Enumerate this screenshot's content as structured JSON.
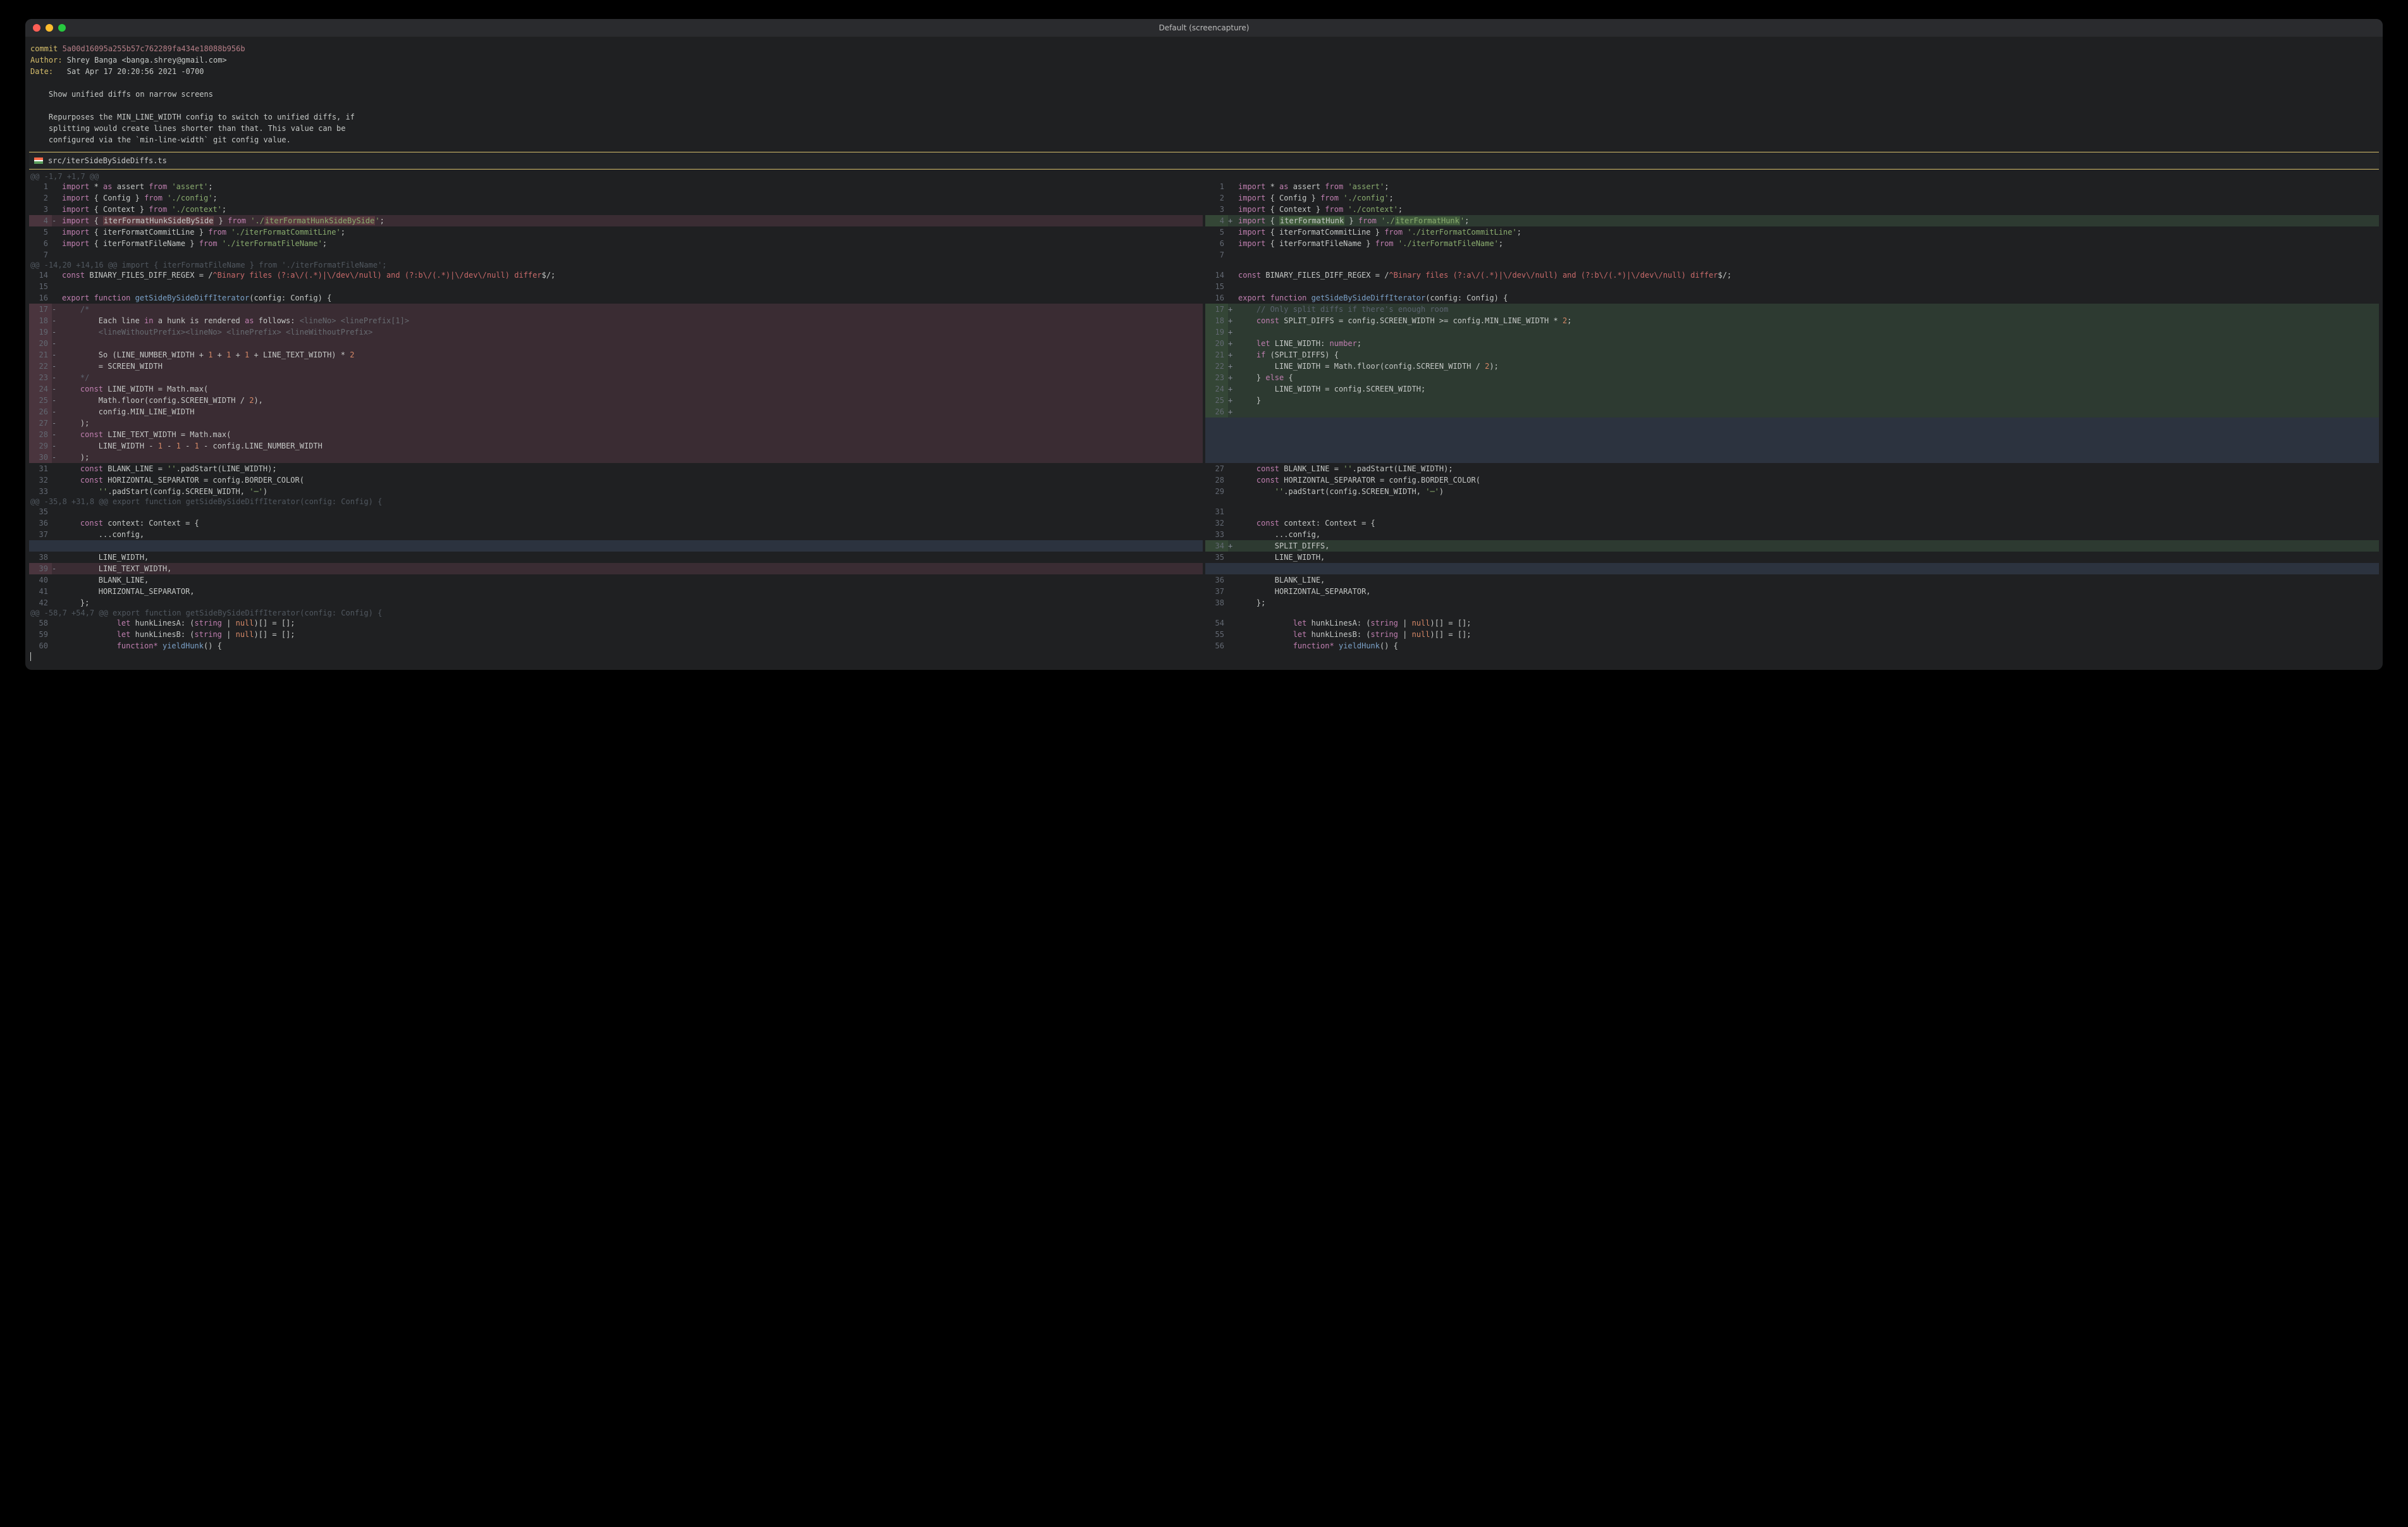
{
  "window": {
    "title": "Default (screencapture)"
  },
  "commit": {
    "label_commit": "commit ",
    "hash": "5a00d16095a255b57c762289fa434e18088b956b",
    "label_author": "Author: ",
    "author": "Shrey Banga <banga.shrey@gmail.com>",
    "label_date": "Date:   ",
    "date": "Sat Apr 17 20:20:56 2021 -0700",
    "subject": "    Show unified diffs on narrow screens",
    "body1": "    Repurposes the MIN_LINE_WIDTH config to switch to unified diffs, if",
    "body2": "    splitting would create lines shorter than that. This value can be",
    "body3": "    configured via the `min-line-width` git config value."
  },
  "file": {
    "path": "src/iterSideBySideDiffs.ts"
  },
  "hunks": {
    "h1": "@@ -1,7 +1,7 @@",
    "h2": "@@ -14,20 +14,16 @@ import { iterFormatFileName } from './iterFormatFileName';",
    "h3": "@@ -35,8 +31,8 @@ export function getSideBySideDiffIterator(config: Config) {",
    "h4": "@@ -58,7 +54,7 @@ export function getSideBySideDiffIterator(config: Config) {"
  },
  "left": {
    "l1_ln": "1",
    "l1": [
      "import",
      " * ",
      "as",
      " assert ",
      "from",
      " ",
      "'assert'",
      ";"
    ],
    "l2_ln": "2",
    "l2": [
      "import",
      " { Config } ",
      "from",
      " ",
      "'./config'",
      ";"
    ],
    "l3_ln": "3",
    "l3": [
      "import",
      " { Context } ",
      "from",
      " ",
      "'./context'",
      ";"
    ],
    "l4_ln": "4",
    "l4a": "import",
    "l4b": " { ",
    "l4hl": "iterFormatHunkSideBySide",
    "l4c": " } ",
    "l4d": "from",
    "l4e": " ",
    "l4f": "'./",
    "l4f2": "iterFormatHunkSideBySide",
    "l4g": "'",
    "l4h": ";",
    "l5_ln": "5",
    "l5": [
      "import",
      " { iterFormatCommitLine } ",
      "from",
      " ",
      "'./iterFormatCommitLine'",
      ";"
    ],
    "l6_ln": "6",
    "l6": [
      "import",
      " { iterFormatFileName } ",
      "from",
      " ",
      "'./iterFormatFileName'",
      ";"
    ],
    "l7_ln": "7",
    "l7": "",
    "l14_ln": "14",
    "l14a": "const",
    "l14b": " BINARY_FILES_DIFF_REGEX = /",
    "l14c": "^Binary files (?:a\\/(.*)|\\/dev\\/null) and (?:b\\/(.*)|\\/dev\\/null) differ",
    "l14d": "$/;",
    "l15_ln": "15",
    "l15": "",
    "l16_ln": "16",
    "l16a": "export",
    "l16b": " ",
    "l16c": "function",
    "l16d": " ",
    "l16e": "getSideBySideDiffIterator",
    "l16f": "(config: Config) {",
    "l17_ln": "17",
    "l17": "    /*",
    "l18_ln": "18",
    "l18a": "        Each line ",
    "l18b": "in",
    "l18c": " a hunk is rendered ",
    "l18d": "as",
    "l18e": " follows: ",
    "l18f": "<lineNo>",
    "l18g": " ",
    "l18h": "<linePrefix[1]>",
    "l19_ln": "19",
    "l19a": "        ",
    "l19b": "<lineWithoutPrefix><lineNo>",
    "l19c": " ",
    "l19d": "<linePrefix>",
    "l19e": " ",
    "l19f": "<lineWithoutPrefix>",
    "l20_ln": "20",
    "l20": "",
    "l21_ln": "21",
    "l21a": "        So (LINE_NUMBER_WIDTH + ",
    "l21b": "1",
    "l21c": " + ",
    "l21d": "1",
    "l21e": " + ",
    "l21f": "1",
    "l21g": " + LINE_TEXT_WIDTH) * ",
    "l21h": "2",
    "l22_ln": "22",
    "l22": "        = SCREEN_WIDTH",
    "l23_ln": "23",
    "l23": "    */",
    "l24_ln": "24",
    "l24a": "    ",
    "l24b": "const",
    "l24c": " LINE_WIDTH = Math.max(",
    "l25_ln": "25",
    "l25a": "        Math.floor(config.SCREEN_WIDTH / ",
    "l25b": "2",
    "l25c": "),",
    "l26_ln": "26",
    "l26": "        config.MIN_LINE_WIDTH",
    "l27_ln": "27",
    "l27": "    );",
    "l28_ln": "28",
    "l28a": "    ",
    "l28b": "const",
    "l28c": " LINE_TEXT_WIDTH = Math.max(",
    "l29_ln": "29",
    "l29a": "        LINE_WIDTH - ",
    "l29b": "1",
    "l29c": " - ",
    "l29d": "1",
    "l29e": " - ",
    "l29f": "1",
    "l29g": " - config.LINE_NUMBER_WIDTH",
    "l30_ln": "30",
    "l30": "    );",
    "l31_ln": "31",
    "l31a": "    ",
    "l31b": "const",
    "l31c": " BLANK_LINE = ",
    "l31d": "''",
    "l31e": ".padStart(LINE_WIDTH);",
    "l32_ln": "32",
    "l32a": "    ",
    "l32b": "const",
    "l32c": " HORIZONTAL_SEPARATOR = config.BORDER_COLOR(",
    "l33_ln": "33",
    "l33a": "        ",
    "l33b": "''",
    "l33c": ".padStart(config.SCREEN_WIDTH, ",
    "l33d": "'─'",
    "l33e": ")",
    "l36_ln": "36",
    "l36a": "    ",
    "l36b": "const",
    "l36c": " context: Context = {",
    "l37_ln": "37",
    "l37": "        ...config,",
    "l38_ln": "38",
    "l38": "        LINE_WIDTH,",
    "l39_ln": "39",
    "l39": "        LINE_TEXT_WIDTH,",
    "l40_ln": "40",
    "l40": "        BLANK_LINE,",
    "l41_ln": "41",
    "l41": "        HORIZONTAL_SEPARATOR,",
    "l42_ln": "42",
    "l42": "    };",
    "l58_ln": "58",
    "l58a": "            ",
    "l58b": "let",
    "l58c": " hunkLinesA: (",
    "l58d": "string",
    "l58e": " | ",
    "l58f": "null",
    "l58g": ")[] = [];",
    "l59_ln": "59",
    "l59a": "            ",
    "l59b": "let",
    "l59c": " hunkLinesB: (",
    "l59d": "string",
    "l59e": " | ",
    "l59f": "null",
    "l59g": ")[] = [];",
    "l60_ln": "60",
    "l60a": "            ",
    "l60b": "function*",
    "l60c": " ",
    "l60d": "yieldHunk",
    "l60e": "() {"
  },
  "right": {
    "l1_ln": "1",
    "l2_ln": "2",
    "l3_ln": "3",
    "l4_ln": "4",
    "l4a": "import",
    "l4b": " { ",
    "l4hl": "iterFormatHunk",
    "l4c": " } ",
    "l4d": "from",
    "l4e": " ",
    "l4f": "'./",
    "l4f2": "iterFormatHunk",
    "l4g": "'",
    "l4h": ";",
    "l5_ln": "5",
    "l6_ln": "6",
    "l7_ln": "7",
    "l14_ln": "14",
    "l15_ln": "15",
    "l16_ln": "16",
    "l17_ln": "17",
    "l17": "    // Only split diffs if there's enough room",
    "l18_ln": "18",
    "l18a": "    ",
    "l18b": "const",
    "l18c": " SPLIT_DIFFS = config.SCREEN_WIDTH >= config.MIN_LINE_WIDTH * ",
    "l18d": "2",
    "l18e": ";",
    "l19_ln": "19",
    "l19": "",
    "l20_ln": "20",
    "l20a": "    ",
    "l20b": "let",
    "l20c": " LINE_WIDTH: ",
    "l20d": "number",
    "l20e": ";",
    "l21_ln": "21",
    "l21a": "    ",
    "l21b": "if",
    "l21c": " (SPLIT_DIFFS) {",
    "l22_ln": "22",
    "l22a": "        LINE_WIDTH = Math.floor(config.SCREEN_WIDTH / ",
    "l22b": "2",
    "l22c": ");",
    "l23_ln": "23",
    "l23a": "    } ",
    "l23b": "else",
    "l23c": " {",
    "l24_ln": "24",
    "l24": "        LINE_WIDTH = config.SCREEN_WIDTH;",
    "l25_ln": "25",
    "l25": "    }",
    "l26_ln": "26",
    "l26": "",
    "l27_ln": "27",
    "l28_ln": "28",
    "l29_ln": "29",
    "l31_ln": "31",
    "l32_ln": "32",
    "l33_ln": "33",
    "l34_ln": "34",
    "l34": "        SPLIT_DIFFS,",
    "l35_ln": "35",
    "l35": "        LINE_WIDTH,",
    "l36_ln": "36",
    "l37_ln": "37",
    "l38_ln": "38",
    "l54_ln": "54",
    "l55_ln": "55",
    "l56_ln": "56"
  }
}
